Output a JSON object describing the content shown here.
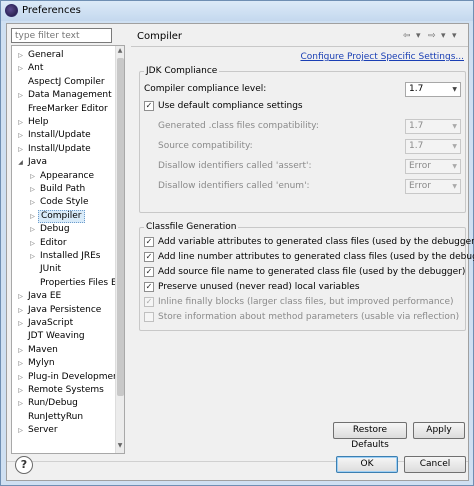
{
  "window": {
    "title": "Preferences"
  },
  "filter": {
    "placeholder": "type filter text"
  },
  "tree": [
    {
      "label": "General",
      "indent": 0,
      "arrow": "right"
    },
    {
      "label": "Ant",
      "indent": 0,
      "arrow": "right"
    },
    {
      "label": "AspectJ Compiler",
      "indent": 0,
      "arrow": ""
    },
    {
      "label": "Data Management",
      "indent": 0,
      "arrow": "right"
    },
    {
      "label": "FreeMarker Editor",
      "indent": 0,
      "arrow": ""
    },
    {
      "label": "Help",
      "indent": 0,
      "arrow": "right"
    },
    {
      "label": "Install/Update",
      "indent": 0,
      "arrow": "right"
    },
    {
      "label": "Install/Update",
      "indent": 0,
      "arrow": "right"
    },
    {
      "label": "Java",
      "indent": 0,
      "arrow": "down"
    },
    {
      "label": "Appearance",
      "indent": 1,
      "arrow": "right"
    },
    {
      "label": "Build Path",
      "indent": 1,
      "arrow": "right"
    },
    {
      "label": "Code Style",
      "indent": 1,
      "arrow": "right"
    },
    {
      "label": "Compiler",
      "indent": 1,
      "arrow": "right",
      "selected": true
    },
    {
      "label": "Debug",
      "indent": 1,
      "arrow": "right"
    },
    {
      "label": "Editor",
      "indent": 1,
      "arrow": "right"
    },
    {
      "label": "Installed JREs",
      "indent": 1,
      "arrow": "right"
    },
    {
      "label": "JUnit",
      "indent": 1,
      "arrow": ""
    },
    {
      "label": "Properties Files Ed",
      "indent": 1,
      "arrow": ""
    },
    {
      "label": "Java EE",
      "indent": 0,
      "arrow": "right"
    },
    {
      "label": "Java Persistence",
      "indent": 0,
      "arrow": "right"
    },
    {
      "label": "JavaScript",
      "indent": 0,
      "arrow": "right"
    },
    {
      "label": "JDT Weaving",
      "indent": 0,
      "arrow": ""
    },
    {
      "label": "Maven",
      "indent": 0,
      "arrow": "right"
    },
    {
      "label": "Mylyn",
      "indent": 0,
      "arrow": "right"
    },
    {
      "label": "Plug-in Development",
      "indent": 0,
      "arrow": "right"
    },
    {
      "label": "Remote Systems",
      "indent": 0,
      "arrow": "right"
    },
    {
      "label": "Run/Debug",
      "indent": 0,
      "arrow": "right"
    },
    {
      "label": "RunJettyRun",
      "indent": 0,
      "arrow": ""
    },
    {
      "label": "Server",
      "indent": 0,
      "arrow": "right"
    }
  ],
  "page": {
    "title": "Compiler",
    "configure_link": "Configure Project Specific Settings..."
  },
  "jdk": {
    "group_title": "JDK Compliance",
    "compliance_label": "Compiler compliance level:",
    "compliance_value": "1.7",
    "use_default_label": "Use default compliance settings",
    "use_default_checked": true,
    "settings": [
      {
        "label": "Generated .class files compatibility:",
        "value": "1.7"
      },
      {
        "label": "Source compatibility:",
        "value": "1.7"
      },
      {
        "label": "Disallow identifiers called 'assert':",
        "value": "Error"
      },
      {
        "label": "Disallow identifiers called 'enum':",
        "value": "Error"
      }
    ]
  },
  "classfile": {
    "group_title": "Classfile Generation",
    "options": [
      {
        "label": "Add variable attributes to generated class files (used by the debugger)",
        "checked": true,
        "enabled": true
      },
      {
        "label": "Add line number attributes to generated class files (used by the debugger)",
        "checked": true,
        "enabled": true
      },
      {
        "label": "Add source file name to generated class file (used by the debugger)",
        "checked": true,
        "enabled": true
      },
      {
        "label": "Preserve unused (never read) local variables",
        "checked": true,
        "enabled": true
      },
      {
        "label": "Inline finally blocks (larger class files, but improved performance)",
        "checked": true,
        "enabled": false
      },
      {
        "label": "Store information about method parameters (usable via reflection)",
        "checked": false,
        "enabled": false
      }
    ]
  },
  "buttons": {
    "restore_defaults": "Restore Defaults",
    "apply": "Apply",
    "ok": "OK",
    "cancel": "Cancel"
  }
}
